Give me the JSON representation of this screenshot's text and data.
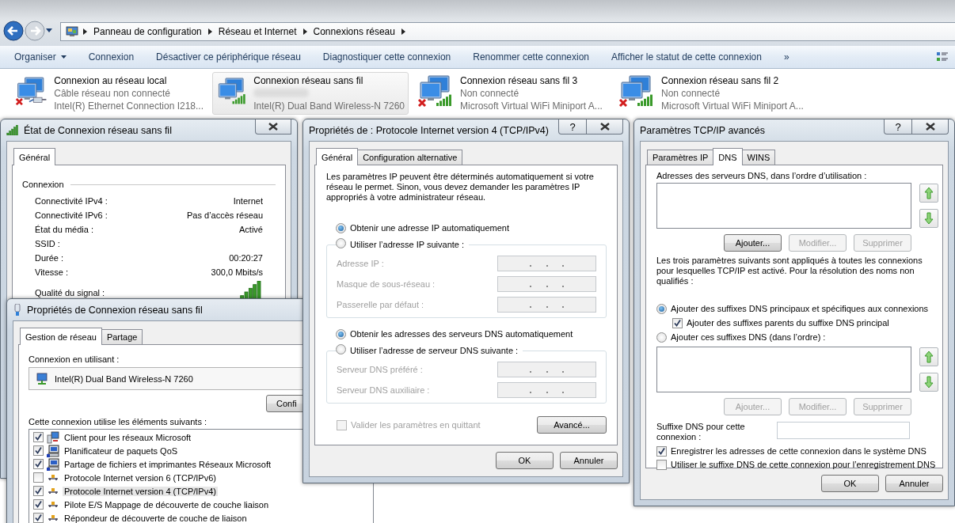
{
  "explorer": {
    "breadcrumb": [
      "Panneau de configuration",
      "Réseau et Internet",
      "Connexions réseau"
    ],
    "toolbar": [
      {
        "label": "Organiser",
        "kind": "menu"
      },
      {
        "label": "Connexion",
        "kind": "plain"
      },
      {
        "label": "Désactiver ce périphérique réseau",
        "kind": "plain"
      },
      {
        "label": "Diagnostiquer cette connexion",
        "kind": "plain"
      },
      {
        "label": "Renommer cette connexion",
        "kind": "plain"
      },
      {
        "label": "Afficher le statut de cette connexion",
        "kind": "plain"
      }
    ],
    "toolbar_overflow": "»",
    "connections": [
      {
        "name": "Connexion au réseau local",
        "status": "Câble réseau non connecté",
        "adapter": "Intel(R) Ethernet Connection I218...",
        "kind": "wired",
        "disconnected": true,
        "selected": false
      },
      {
        "name": "Connexion réseau sans fil",
        "adapter": "Intel(R) Dual Band Wireless-N 7260",
        "kind": "wireless",
        "disconnected": false,
        "selected": true
      },
      {
        "name": "Connexion réseau sans fil 3",
        "status": "Non connecté",
        "adapter": "Microsoft Virtual WiFi Miniport A...",
        "kind": "wireless",
        "disconnected": true,
        "selected": false
      },
      {
        "name": "Connexion réseau sans fil 2",
        "status": "Non connecté",
        "adapter": "Microsoft Virtual WiFi Miniport A...",
        "kind": "wireless",
        "disconnected": true,
        "selected": false
      }
    ]
  },
  "status_window": {
    "title": "État de Connexion réseau sans fil",
    "tabs": [
      {
        "label": "Général",
        "selected": true
      }
    ],
    "group": "Connexion",
    "rows": [
      {
        "label": "Connectivité IPv4 :",
        "value": "Internet"
      },
      {
        "label": "Connectivité IPv6 :",
        "value": "Pas d’accès réseau"
      },
      {
        "label": "État du média :",
        "value": "Activé"
      },
      {
        "label": "SSID :"
      },
      {
        "label": "Durée :",
        "value": "00:20:27"
      },
      {
        "label": "Vitesse :",
        "value": "300,0 Mbits/s"
      }
    ],
    "signal_label": "Qualité du signal :"
  },
  "properties_window": {
    "title": "Propriétés de Connexion réseau sans fil",
    "tabs": [
      {
        "label": "Gestion de réseau",
        "selected": true
      },
      {
        "label": "Partage",
        "selected": false
      }
    ],
    "adapter_label": "Connexion en utilisant :",
    "adapter": "Intel(R) Dual Band Wireless-N 7260",
    "configure_button": "Confi",
    "items_label": "Cette connexion utilise les éléments suivants :",
    "items": [
      {
        "label": "Client pour les réseaux Microsoft",
        "checked": true,
        "selected": false,
        "kind": "client"
      },
      {
        "label": "Planificateur de paquets QoS",
        "checked": true,
        "selected": false,
        "kind": "service"
      },
      {
        "label": "Partage de fichiers et imprimantes Réseaux Microsoft",
        "checked": true,
        "selected": false,
        "kind": "service"
      },
      {
        "label": "Protocole Internet version 6 (TCP/IPv6)",
        "checked": false,
        "selected": false,
        "kind": "protocol"
      },
      {
        "label": "Protocole Internet version 4 (TCP/IPv4)",
        "checked": true,
        "selected": true,
        "kind": "protocol"
      },
      {
        "label": "Pilote E/S Mappage de découverte de couche liaison",
        "checked": true,
        "selected": false,
        "kind": "protocol"
      },
      {
        "label": "Répondeur de découverte de couche de liaison",
        "checked": true,
        "selected": false,
        "kind": "protocol"
      }
    ]
  },
  "ipv4_window": {
    "title": "Propriétés de : Protocole Internet version 4 (TCP/IPv4)",
    "help": "?",
    "tabs": [
      {
        "label": "Général",
        "selected": true
      },
      {
        "label": "Configuration alternative",
        "selected": false
      }
    ],
    "description": "Les paramètres IP peuvent être déterminés automatiquement si votre réseau le permet. Sinon, vous devez demander les paramètres IP appropriés à votre administrateur réseau.",
    "groups": [
      {
        "options": [
          {
            "label": "Obtenir une adresse IP automatiquement",
            "selected": true
          },
          {
            "label": "Utiliser l’adresse IP suivante :",
            "selected": false
          }
        ],
        "fields": [
          {
            "label": "Adresse IP :",
            "disabled": true
          },
          {
            "label": "Masque de sous-réseau :",
            "disabled": true
          },
          {
            "label": "Passerelle par défaut :",
            "disabled": true
          }
        ]
      },
      {
        "options": [
          {
            "label": "Obtenir les adresses des serveurs DNS automatiquement",
            "selected": true
          },
          {
            "label": "Utiliser l’adresse de serveur DNS suivante :",
            "selected": false
          }
        ],
        "fields": [
          {
            "label": "Serveur DNS préféré :",
            "disabled": true
          },
          {
            "label": "Serveur DNS auxiliaire :",
            "disabled": true
          }
        ]
      }
    ],
    "validate": {
      "label": "Valider les paramètres en quittant",
      "checked": false,
      "disabled": true
    },
    "advanced_button": "Avancé...",
    "buttons": [
      "OK",
      "Annuler"
    ]
  },
  "advanced_window": {
    "title": "Paramètres TCP/IP avancés",
    "help": "?",
    "tabs": [
      {
        "label": "Paramètres IP",
        "selected": false
      },
      {
        "label": "DNS",
        "selected": true
      },
      {
        "label": "WINS",
        "selected": false
      }
    ],
    "servers_label": "Adresses des serveurs DNS, dans l’ordre d’utilisation :",
    "server_buttons": [
      {
        "label": "Ajouter...",
        "disabled": false
      },
      {
        "label": "Modifier...",
        "disabled": true
      },
      {
        "label": "Supprimer",
        "disabled": true
      }
    ],
    "note": "Les trois paramètres suivants sont appliqués à toutes les connexions pour lesquelles TCP/IP est activé. Pour la résolution des noms non qualifiés :",
    "suffix_mode": [
      {
        "label": "Ajouter des suffixes DNS principaux et spécifiques aux connexions",
        "selected": true
      },
      {
        "label": "Ajouter ces suffixes DNS (dans l’ordre) :",
        "selected": false
      }
    ],
    "parent_suffixes": {
      "label": "Ajouter des suffixes parents du suffixe DNS principal",
      "checked": true
    },
    "suffix_buttons": [
      {
        "label": "Ajouter...",
        "disabled": true
      },
      {
        "label": "Modifier...",
        "disabled": true
      },
      {
        "label": "Supprimer",
        "disabled": true
      }
    ],
    "suffix_label": "Suffixe DNS pour cette connexion :",
    "register_options": [
      {
        "label": "Enregistrer les adresses de cette connexion dans le système DNS",
        "checked": true
      },
      {
        "label": "Utiliser le suffixe DNS de cette connexion pour l’enregistrement DNS",
        "checked": false
      }
    ],
    "buttons": [
      "OK",
      "Annuler"
    ]
  }
}
